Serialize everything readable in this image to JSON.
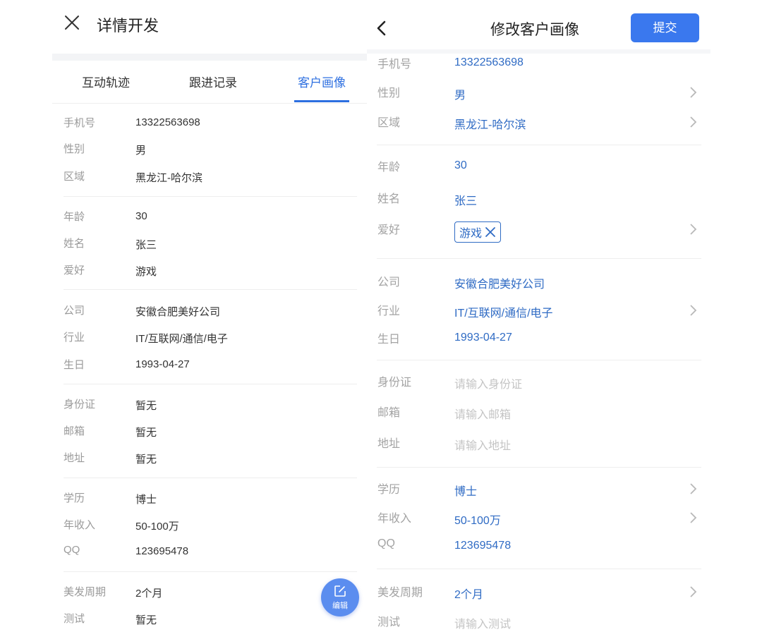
{
  "left": {
    "title": "详情开发",
    "tabs": [
      "互动轨迹",
      "跟进记录",
      "客户画像"
    ],
    "active_tab": 2,
    "fields": [
      {
        "label": "手机号",
        "value": "13322563698"
      },
      {
        "label": "性别",
        "value": "男"
      },
      {
        "label": "区域",
        "value": "黑龙江-哈尔滨"
      },
      {
        "label": "年龄",
        "value": "30"
      },
      {
        "label": "姓名",
        "value": "张三"
      },
      {
        "label": "爱好",
        "value": "游戏"
      },
      {
        "label": "公司",
        "value": "安徽合肥美好公司"
      },
      {
        "label": "行业",
        "value": "IT/互联网/通信/电子"
      },
      {
        "label": "生日",
        "value": "1993-04-27"
      },
      {
        "label": "身份证",
        "value": "暂无"
      },
      {
        "label": "邮箱",
        "value": "暂无"
      },
      {
        "label": "地址",
        "value": "暂无"
      },
      {
        "label": "学历",
        "value": "博士"
      },
      {
        "label": "年收入",
        "value": "50-100万"
      },
      {
        "label": "QQ",
        "value": "123695478"
      },
      {
        "label": "美发周期",
        "value": "2个月"
      },
      {
        "label": "测试",
        "value": "暂无"
      }
    ],
    "fab_label": "编辑",
    "icons": {
      "close": "close-icon",
      "fab": "edit-icon"
    },
    "accent_color": "#2d6fe0"
  },
  "right": {
    "title": "修改客户画像",
    "submit_label": "提交",
    "fields": [
      {
        "label": "手机号",
        "value": "13322563698"
      },
      {
        "label": "性别",
        "value": "男"
      },
      {
        "label": "区域",
        "value": "黑龙江-哈尔滨"
      },
      {
        "label": "年龄",
        "value": "30"
      },
      {
        "label": "姓名",
        "value": "张三"
      },
      {
        "label": "爱好",
        "value": "游戏"
      },
      {
        "label": "公司",
        "value": "安徽合肥美好公司"
      },
      {
        "label": "行业",
        "value": "IT/互联网/通信/电子"
      },
      {
        "label": "生日",
        "value": "1993-04-27"
      },
      {
        "label": "身份证",
        "placeholder": "请输入身份证"
      },
      {
        "label": "邮箱",
        "placeholder": "请输入邮箱"
      },
      {
        "label": "地址",
        "placeholder": "请输入地址"
      },
      {
        "label": "学历",
        "value": "博士"
      },
      {
        "label": "年收入",
        "value": "50-100万"
      },
      {
        "label": "QQ",
        "value": "123695478"
      },
      {
        "label": "美发周期",
        "value": "2个月"
      },
      {
        "label": "测试",
        "placeholder": "请输入测试"
      }
    ],
    "icons": {
      "back": "chevron-left-icon",
      "row": "chevron-right-icon",
      "tag_remove": "close-icon"
    },
    "value_color": "#2f6bc4",
    "button_color": "#3a78ee"
  }
}
